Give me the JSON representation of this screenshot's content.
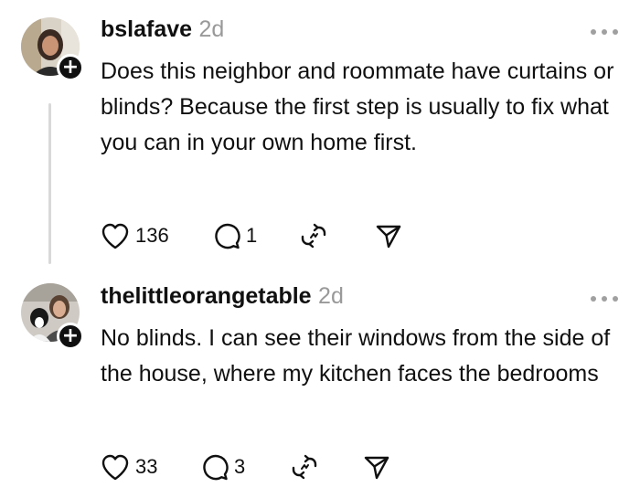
{
  "posts": [
    {
      "username": "bslafave",
      "timestamp": "2d",
      "text": "Does this neighbor and roommate have curtains or blinds? Because the first step is usually to fix what you can in your own home first.",
      "likes": "136",
      "replies": "1"
    },
    {
      "username": "thelittleorangetable",
      "timestamp": "2d",
      "text": "No blinds. I can see their windows from the side of the house, where my kitchen faces the bedrooms",
      "likes": "33",
      "replies": "3"
    }
  ],
  "follow_symbol": "+",
  "icons": [
    "heart-icon",
    "comment-icon",
    "repost-icon",
    "share-icon",
    "more-icon",
    "plus-icon"
  ]
}
